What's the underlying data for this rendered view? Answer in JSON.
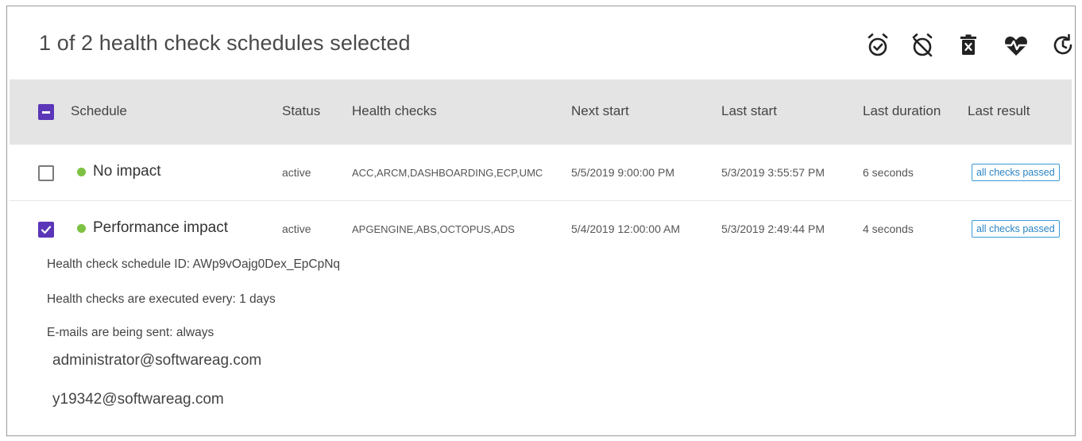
{
  "header": {
    "title": "1 of 2 health check schedules selected",
    "toolbar_icons": [
      "alarm-on-icon",
      "alarm-off-icon",
      "delete-icon",
      "health-check-icon",
      "refresh-icon"
    ]
  },
  "table": {
    "columns": {
      "schedule": "Schedule",
      "status": "Status",
      "health_checks": "Health checks",
      "next_start": "Next start",
      "last_start": "Last start",
      "last_duration": "Last duration",
      "last_result": "Last result"
    },
    "select_all_state": "indeterminate",
    "rows": [
      {
        "selected": false,
        "name": "No impact",
        "status": "active",
        "health_checks": "ACC,ARCM,DASHBOARDING,ECP,UMC",
        "next_start": "5/5/2019 9:00:00 PM",
        "last_start": "5/3/2019 3:55:57 PM",
        "last_duration": "6 seconds",
        "last_result": "all checks passed"
      },
      {
        "selected": true,
        "name": "Performance impact",
        "status": "active",
        "health_checks": "APGENGINE,ABS,OCTOPUS,ADS",
        "next_start": "5/4/2019 12:00:00 AM",
        "last_start": "5/3/2019 2:49:44 PM",
        "last_duration": "4 seconds",
        "last_result": "all checks passed"
      }
    ]
  },
  "details": {
    "schedule_id": "Health check schedule ID: AWp9vOajg0Dex_EpCpNq",
    "interval": "Health checks are executed every: 1 days",
    "emails_sent": "E-mails are being sent: always",
    "recipients": [
      "administrator@softwareag.com",
      "y19342@softwareag.com"
    ]
  },
  "colors": {
    "accent": "#5b36b8",
    "status_dot": "#7dc242",
    "badge_border": "#3a9ad9",
    "header_bg": "#e4e4e4"
  }
}
